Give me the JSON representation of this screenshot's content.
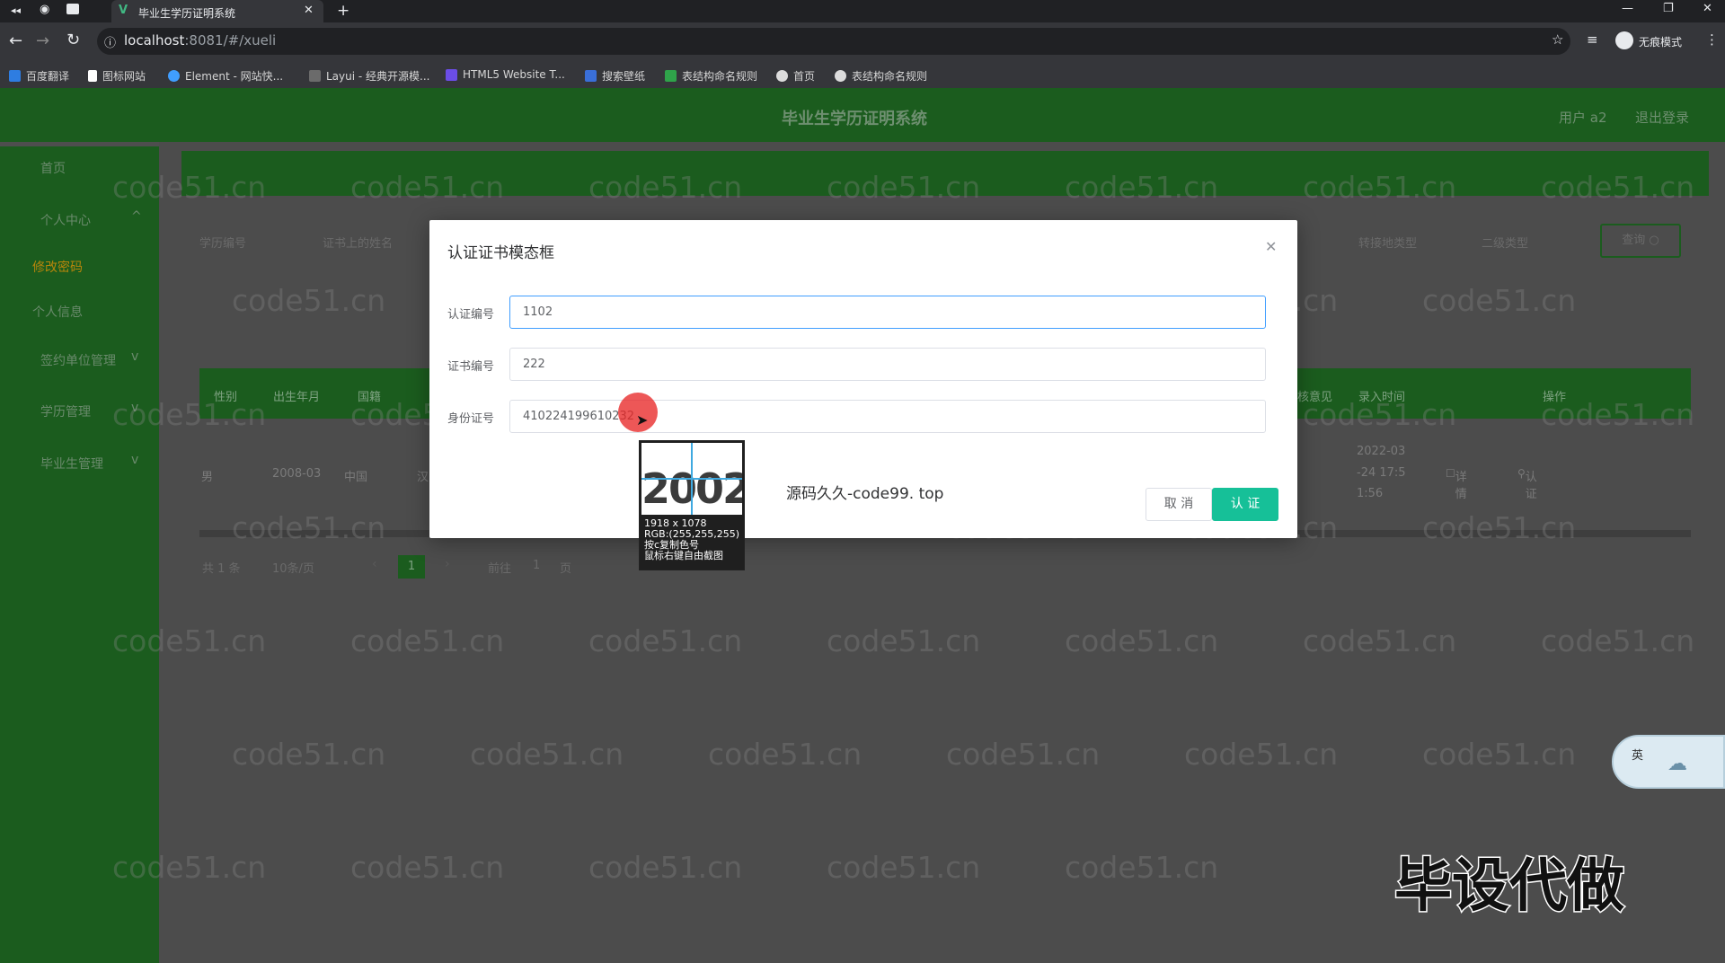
{
  "browser": {
    "tab_title": "毕业生学历证明系统",
    "url_host": "localhost",
    "url_rest": ":8081/#/xueli",
    "profile_label": "无痕模式",
    "bookmarks": [
      "百度翻译",
      "图标网站",
      "Element - 网站快...",
      "Layui - 经典开源模...",
      "HTML5 Website T...",
      "搜索壁纸",
      "表结构命名规则",
      "首页",
      "表结构命名规则"
    ]
  },
  "app": {
    "title": "毕业生学历证明系统",
    "user_label": "用户 a2",
    "logout_label": "退出登录"
  },
  "sidebar": {
    "items": [
      {
        "label": "首页"
      },
      {
        "label": "个人中心",
        "chevron": "^"
      },
      {
        "label": "修改密码"
      },
      {
        "label": "个人信息"
      },
      {
        "label": "签约单位管理",
        "chevron": "v"
      },
      {
        "label": "学历管理",
        "chevron": "v"
      },
      {
        "label": "毕业生管理",
        "chevron": "v"
      }
    ]
  },
  "filters": {
    "field1": "学历编号",
    "field2": "证书上的姓名",
    "field3": "转接地类型",
    "field4": "二级类型",
    "query_label": "查询"
  },
  "table": {
    "columns": [
      "性别",
      "出生年月",
      "国籍",
      "核意见",
      "录入时间",
      "操作"
    ],
    "row": {
      "gender": "男",
      "birth": "2008-03",
      "nationality": "中国",
      "ethnic": "汉",
      "time_line1": "2022-03",
      "time_line2": "-24 17:5",
      "time_line3": "1:56",
      "detail_label": "详情",
      "cert_label": "认证"
    }
  },
  "pagination": {
    "total": "共 1 条",
    "per_page": "10条/页",
    "current": "1",
    "goto_label": "前往",
    "goto_value": "1",
    "page_suffix": "页"
  },
  "modal": {
    "title": "认证证书模态框",
    "fields": [
      {
        "label": "认证编号",
        "value": "1102"
      },
      {
        "label": "证书编号",
        "value": "222"
      },
      {
        "label": "身份证号",
        "value": "410224199610232"
      }
    ],
    "cancel_label": "取 消",
    "confirm_label": "认 证",
    "promo_text": "源码久久-code99. top"
  },
  "color_picker": {
    "preview_text": "2002",
    "line1": "1918 x 1078",
    "line2": "RGB:(255,255,255)",
    "line3": "按c复制色号",
    "line4": "鼠标右键自由截图"
  },
  "watermark": "code51.cn",
  "overlay_caption": "毕设代做",
  "ime_label": "英",
  "colors": {
    "accent_green": "#1b5c1e",
    "primary_teal": "#16c098",
    "focus_blue": "#409eff"
  }
}
